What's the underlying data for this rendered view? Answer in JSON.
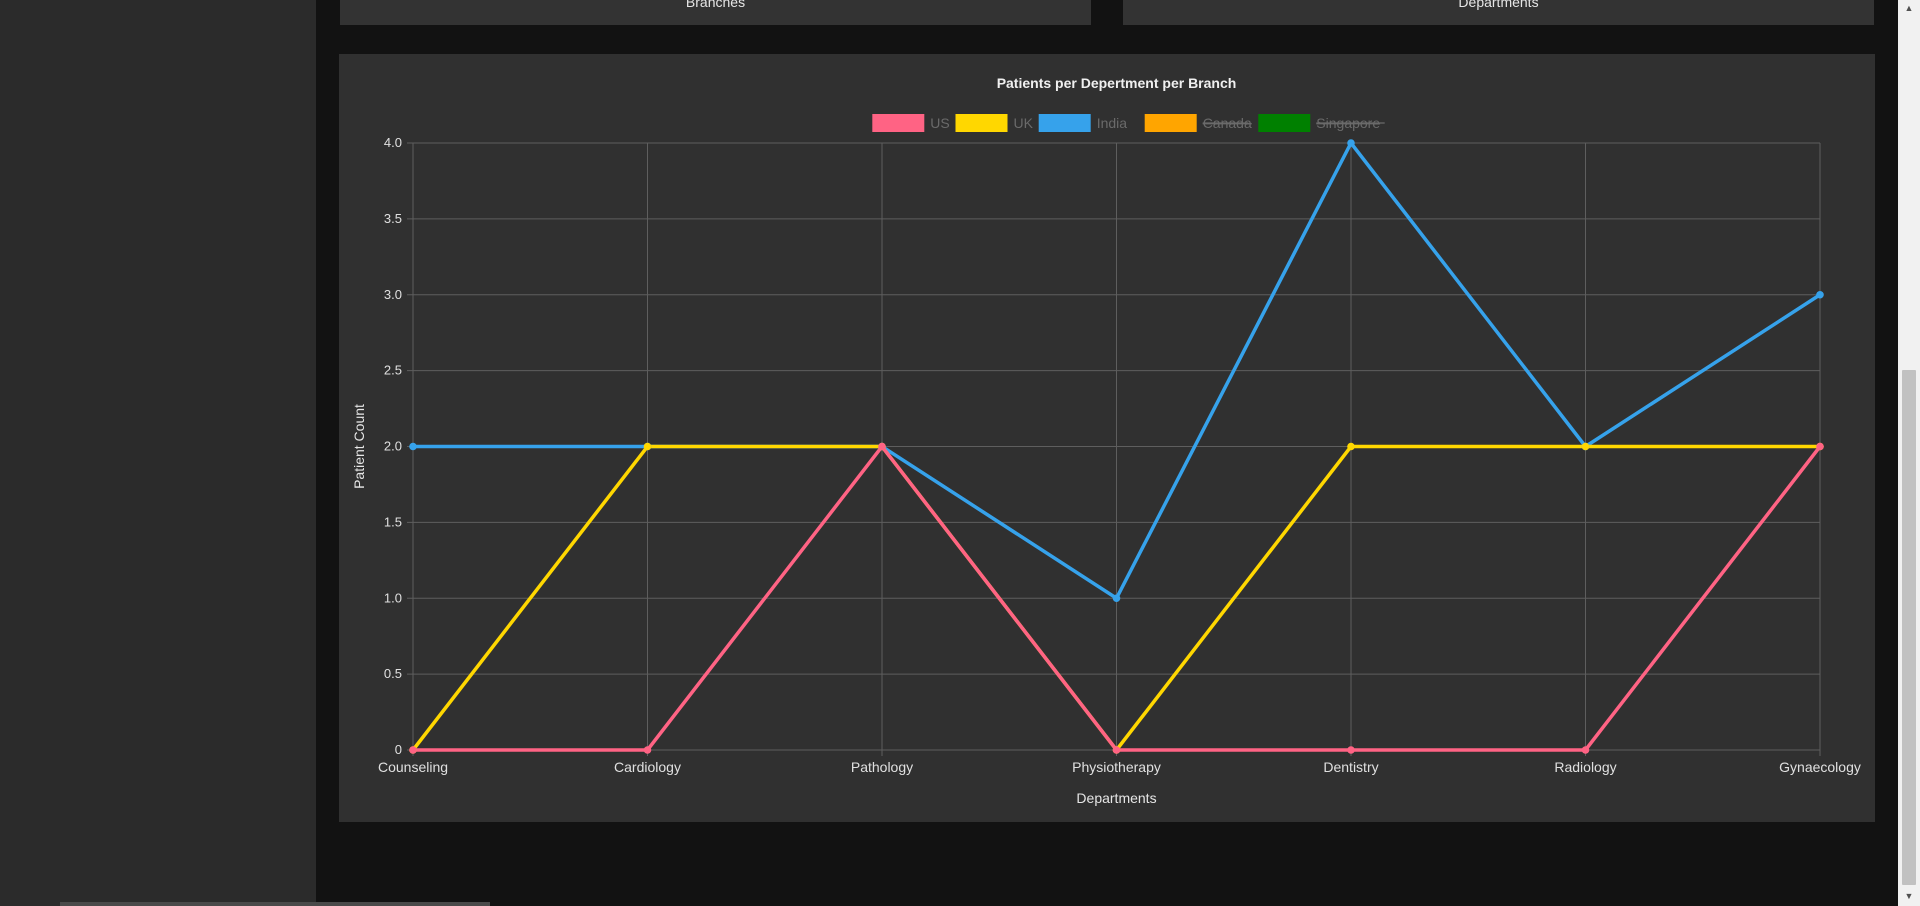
{
  "cards": {
    "branches_label": "Branches",
    "departments_label": "Departments"
  },
  "chart_data": {
    "type": "line",
    "title": "Patients per Depertment per Branch",
    "xlabel": "Departments",
    "ylabel": "Patient Count",
    "ylim": [
      0,
      4
    ],
    "yticks": [
      "0",
      "0.5",
      "1.0",
      "1.5",
      "2.0",
      "2.5",
      "3.0",
      "3.5",
      "4.0"
    ],
    "categories": [
      "Counseling",
      "Cardiology",
      "Pathology",
      "Physiotherapy",
      "Dentistry",
      "Radiology",
      "Gynaecology"
    ],
    "grid": true,
    "legend_position": "top",
    "series": [
      {
        "name": "US",
        "color": "#ff6384",
        "hidden": false,
        "values": [
          0,
          0,
          2,
          0,
          0,
          0,
          2
        ]
      },
      {
        "name": "UK",
        "color": "#ffd700",
        "hidden": false,
        "values": [
          0,
          2,
          2,
          0,
          2,
          2,
          2
        ]
      },
      {
        "name": "India",
        "color": "#36a2eb",
        "hidden": false,
        "values": [
          2,
          2,
          2,
          1,
          4,
          2,
          3
        ]
      },
      {
        "name": "Canada",
        "color": "#ffa500",
        "hidden": true,
        "values": []
      },
      {
        "name": "Singapore",
        "color": "#008000",
        "hidden": true,
        "values": []
      }
    ]
  },
  "scrollbar": {
    "up_icon": "triangle-up-icon",
    "down_icon": "triangle-down-icon"
  }
}
